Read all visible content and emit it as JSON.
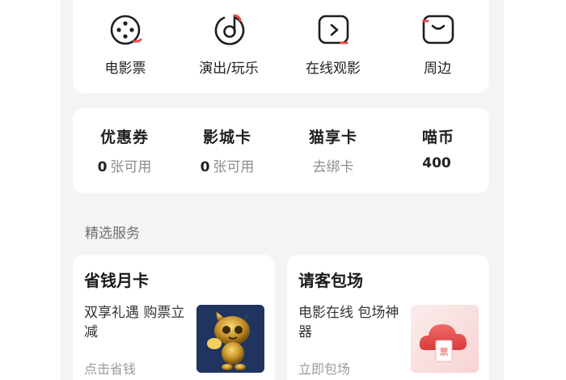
{
  "shortcuts": [
    {
      "label": "电影票",
      "icon": "film-reel-icon"
    },
    {
      "label": "演出/玩乐",
      "icon": "music-disc-icon"
    },
    {
      "label": "在线观影",
      "icon": "play-screen-icon"
    },
    {
      "label": "周边",
      "icon": "merch-bag-icon"
    }
  ],
  "wallet": {
    "items": [
      {
        "title": "优惠券",
        "num": "0",
        "sub": "张可用"
      },
      {
        "title": "影城卡",
        "num": "0",
        "sub": "张可用"
      },
      {
        "title": "猫享卡",
        "num": "",
        "sub": "去绑卡"
      },
      {
        "title": "喵币",
        "num": "400",
        "sub": ""
      }
    ]
  },
  "services": {
    "section_title": "精选服务",
    "cards": [
      {
        "title": "省钱月卡",
        "desc": "双享礼遇 购票立减",
        "link": "点击省钱",
        "image": "gold-cat-mascot"
      },
      {
        "title": "请客包场",
        "desc": "电影在线 包场神器",
        "link": "立即包场",
        "image": "red-cloud-ticket",
        "ticket_char": "票"
      }
    ]
  },
  "colors": {
    "accent": "#e94b4b",
    "background": "#f4f3f5",
    "card": "#ffffff"
  }
}
